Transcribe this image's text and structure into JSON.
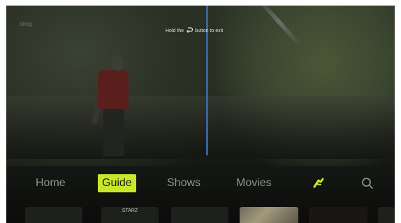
{
  "app": {
    "logo_text": "sling"
  },
  "hint": {
    "before": "Hold the",
    "after": "button to exit",
    "icon": "back-arrow-icon"
  },
  "nav": {
    "items": [
      {
        "label": "Home"
      },
      {
        "label": "Guide"
      },
      {
        "label": "Shows"
      },
      {
        "label": "Movies"
      }
    ],
    "active_index": 1,
    "icons": [
      "sports-icon",
      "search-icon"
    ],
    "accent_color": "#c9e72a",
    "inactive_color": "#8e938b"
  },
  "tiles": [
    {
      "label": ""
    },
    {
      "label": "STARZ"
    },
    {
      "label": ""
    },
    {
      "label": ""
    },
    {
      "label": ""
    },
    {
      "label": ""
    }
  ]
}
